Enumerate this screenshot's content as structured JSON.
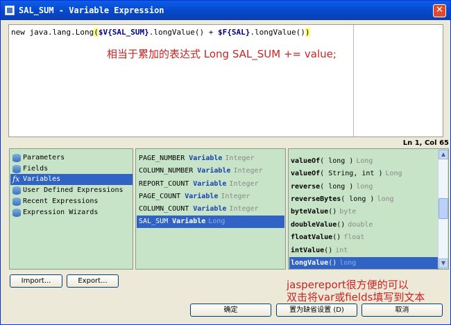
{
  "window": {
    "title": "SAL_SUM - Variable Expression",
    "close_glyph": "✕"
  },
  "editor": {
    "code_prefix": "new java.lang.Long",
    "paren_open": "(",
    "var1": "$V{SAL_SUM}",
    "mid": ".longValue() + ",
    "var2": "$F{SAL}",
    "tail": ".longValue()",
    "paren_close": ")",
    "annotation": "相当于累加的表达式 Long SAL_SUM += value;",
    "status": "Ln 1, Col 65"
  },
  "categories": [
    {
      "label": "Parameters",
      "icon": "database-icon"
    },
    {
      "label": "Fields",
      "icon": "database-icon"
    },
    {
      "label": "Variables",
      "icon": "fx-icon",
      "selected": true
    },
    {
      "label": "User Defined Expressions",
      "icon": "database-icon"
    },
    {
      "label": "Recent Expressions",
      "icon": "database-icon"
    },
    {
      "label": "Expression Wizards",
      "icon": "database-icon"
    }
  ],
  "variables": [
    {
      "name": "PAGE_NUMBER",
      "kind": "Variable",
      "type": "Integer"
    },
    {
      "name": "COLUMN_NUMBER",
      "kind": "Variable",
      "type": "Integer"
    },
    {
      "name": "REPORT_COUNT",
      "kind": "Variable",
      "type": "Integer"
    },
    {
      "name": "PAGE_COUNT",
      "kind": "Variable",
      "type": "Integer"
    },
    {
      "name": "COLUMN_COUNT",
      "kind": "Variable",
      "type": "Integer"
    },
    {
      "name": "SAL_SUM",
      "kind": "Variable",
      "type": "Long",
      "selected": true
    }
  ],
  "methods": [
    {
      "name": "valueOf",
      "args": "( long )",
      "ret": "Long"
    },
    {
      "name": "valueOf",
      "args": "( String, int )",
      "ret": "Long"
    },
    {
      "name": "reverse",
      "args": "( long )",
      "ret": "long"
    },
    {
      "name": "reverseBytes",
      "args": "( long )",
      "ret": "long"
    },
    {
      "name": "byteValue",
      "args": "()",
      "ret": "byte"
    },
    {
      "name": "doubleValue",
      "args": "()",
      "ret": "double"
    },
    {
      "name": "floatValue",
      "args": "()",
      "ret": "float"
    },
    {
      "name": "intValue",
      "args": "()",
      "ret": "int"
    },
    {
      "name": "longValue",
      "args": "()",
      "ret": "long",
      "selected": true
    }
  ],
  "buttons": {
    "import": "Import...",
    "export": "Export...",
    "ok": "确定",
    "apply": "置为缺省设置 (D)",
    "cancel": "取消"
  },
  "bottom_annotation": "jaspereport很方便的可以\n双击将var或fields填写到文本"
}
